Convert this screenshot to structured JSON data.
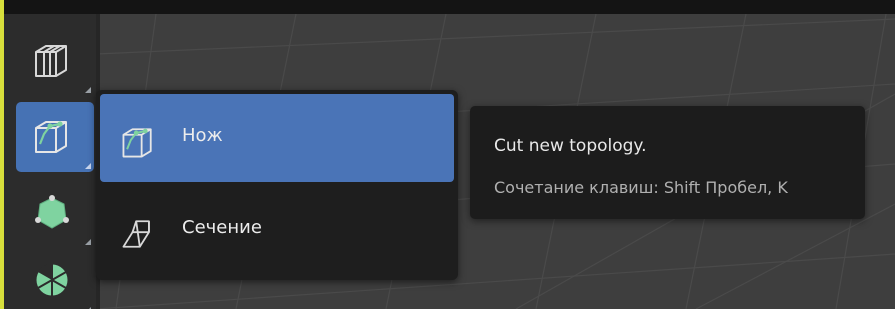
{
  "colors": {
    "accent": "#4a74b7",
    "toolbar_bg": "#2c2c2c",
    "viewport_bg": "#3e3e3e",
    "popup_bg": "#1e1e1e",
    "tooltip_bg": "#1c1c1c",
    "selection_border": "#d7df3c",
    "icon_green": "#7fd3a0"
  },
  "toolbar": {
    "tools": [
      {
        "name": "loop-cut",
        "icon": "loop-cut-icon",
        "active": false
      },
      {
        "name": "knife",
        "icon": "knife-icon",
        "active": true
      },
      {
        "name": "poly-build",
        "icon": "poly-build-icon",
        "active": false
      },
      {
        "name": "spin",
        "icon": "spin-icon",
        "active": false
      }
    ]
  },
  "popup_menu": {
    "items": [
      {
        "label": "Нож",
        "icon": "knife-icon",
        "selected": true
      },
      {
        "label": "Сечение",
        "icon": "bisect-icon",
        "selected": false
      }
    ]
  },
  "tooltip": {
    "title": "Cut new topology.",
    "shortcut": "Сочетание клавиш: Shift Пробел, K"
  }
}
